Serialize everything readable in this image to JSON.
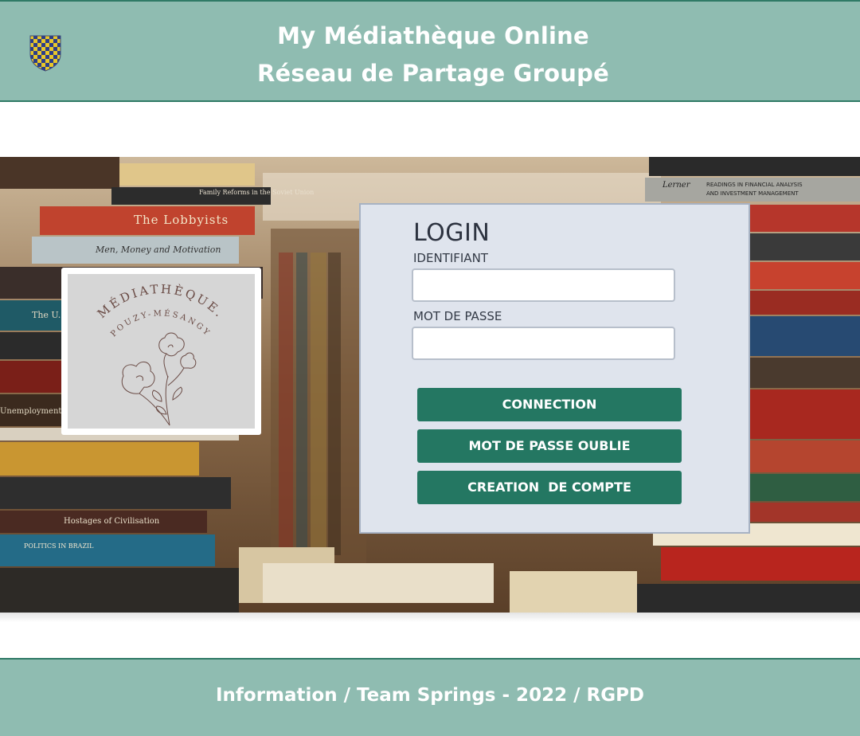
{
  "header": {
    "title": "My Médiathèque Online",
    "subtitle": "Réseau de Partage Groupé",
    "crest_icon": "checkered-shield-crest-icon",
    "background_color": "#8fbcb1",
    "border_color": "#2f7a66"
  },
  "logo": {
    "text_line_1": "MÉDIATHÈQUE.",
    "text_line_2": "POUZY-MÉSANGY",
    "image": "flower-illustration-icon"
  },
  "login": {
    "title": "LOGIN",
    "identifiant_label": "IDENTIFIANT",
    "identifiant_value": "",
    "password_label": "MOT DE PASSE",
    "password_value": "",
    "buttons": {
      "connection": "CONNECTION",
      "forgot": "MOT DE PASSE OUBLIE",
      "create": "CREATION  DE COMPTE"
    },
    "button_color": "#247762",
    "panel_color": "#dfe4ed"
  },
  "hero": {
    "image": "library-books-background",
    "book_spines": {
      "left": [
        "Hostages of Civilisation",
        "The Lobbyists",
        "Men, Money and Motivation",
        "POLITICS IN BRAZIL",
        "Family Reforms in the Soviet Union",
        "The U.S.",
        "Unemployment"
      ],
      "right": [
        "READINGS IN FINANCIAL ANALYSIS",
        "AND INVESTMENT MANAGEMENT",
        "Lerner"
      ]
    }
  },
  "footer": {
    "text": "Information / Team Springs - 2022 / RGPD"
  }
}
